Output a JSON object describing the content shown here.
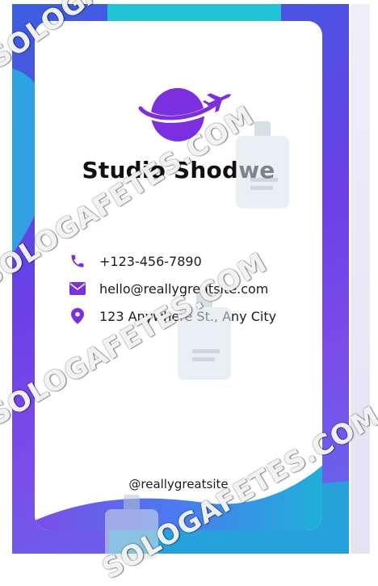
{
  "card": {
    "company_name": "Studio Shodwe",
    "phone": "+123-456-7890",
    "email": "hello@reallygreatsite.com",
    "address": "123 Anywhere St., Any City",
    "social_handle": "@reallygreatsite"
  },
  "watermark": {
    "text_full": "SOLOGAFETES.COM"
  },
  "icons": {
    "logo": "globe-plane-logo",
    "phone": "phone-icon",
    "email": "envelope-icon",
    "address": "map-pin-icon",
    "badge": "id-badge-icon"
  },
  "colors": {
    "brand_purple": "#7b2fe0",
    "background_blue": "#3b5fe0",
    "background_violet": "#6a3fe6",
    "accent_cyan": "#22c3d6",
    "text_dark": "#1c1c1c",
    "watermark_accent": "#f08a4b"
  }
}
